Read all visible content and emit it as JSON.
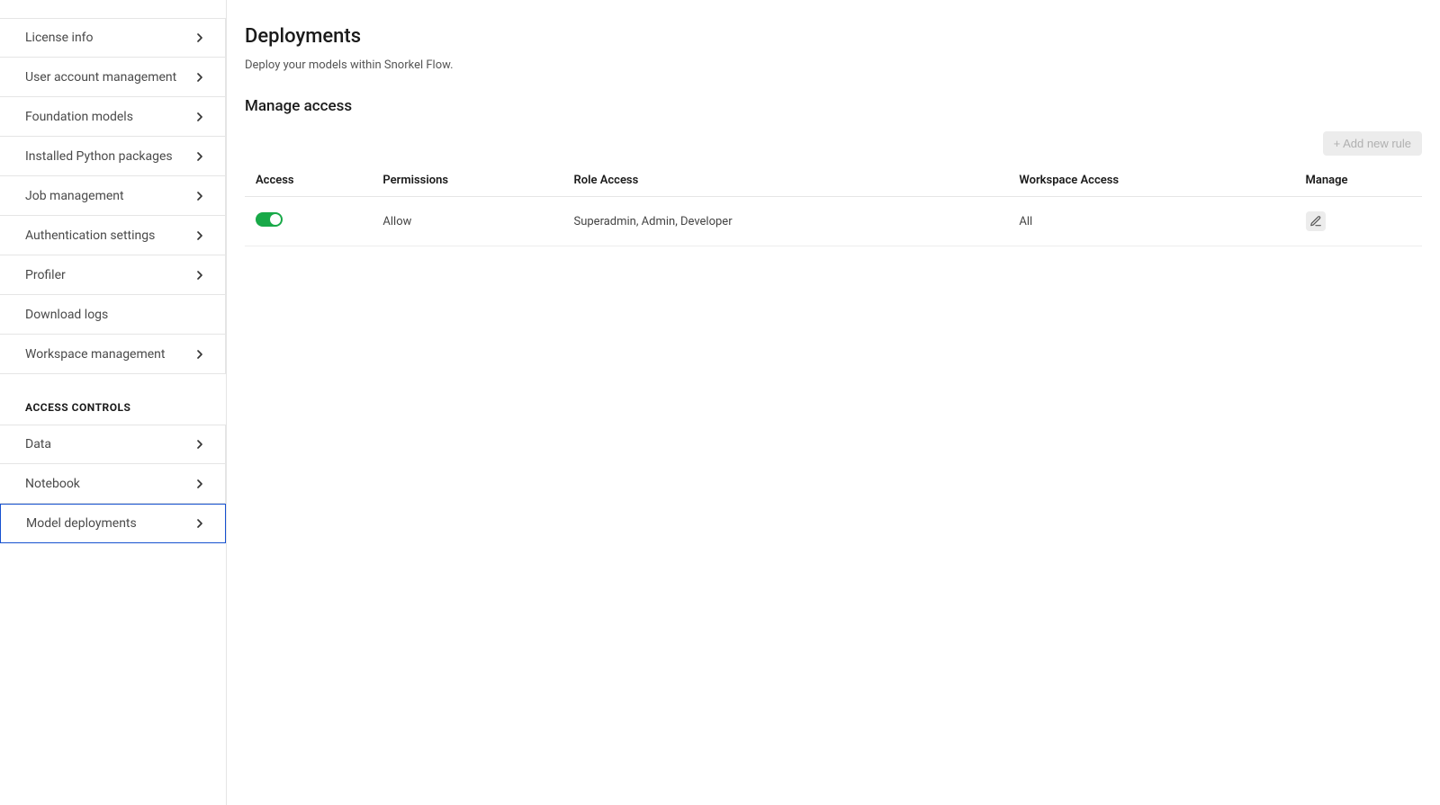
{
  "sidebar": {
    "main_items": [
      {
        "label": "License info",
        "chevron": true
      },
      {
        "label": "User account management",
        "chevron": true
      },
      {
        "label": "Foundation models",
        "chevron": true
      },
      {
        "label": "Installed Python packages",
        "chevron": true
      },
      {
        "label": "Job management",
        "chevron": true
      },
      {
        "label": "Authentication settings",
        "chevron": true
      },
      {
        "label": "Profiler",
        "chevron": true
      },
      {
        "label": "Download logs",
        "chevron": false
      },
      {
        "label": "Workspace management",
        "chevron": true
      }
    ],
    "section_label": "ACCESS CONTROLS",
    "access_items": [
      {
        "label": "Data",
        "chevron": true,
        "active": false
      },
      {
        "label": "Notebook",
        "chevron": true,
        "active": false
      },
      {
        "label": "Model deployments",
        "chevron": true,
        "active": true
      }
    ]
  },
  "main": {
    "title": "Deployments",
    "subtitle": "Deploy your models within Snorkel Flow.",
    "section_title": "Manage access",
    "add_button_label": "+ Add new rule",
    "table": {
      "headers": {
        "access": "Access",
        "permissions": "Permissions",
        "role_access": "Role Access",
        "workspace_access": "Workspace Access",
        "manage": "Manage"
      },
      "rows": [
        {
          "access_on": true,
          "permissions": "Allow",
          "role_access": "Superadmin, Admin, Developer",
          "workspace_access": "All"
        }
      ]
    }
  }
}
